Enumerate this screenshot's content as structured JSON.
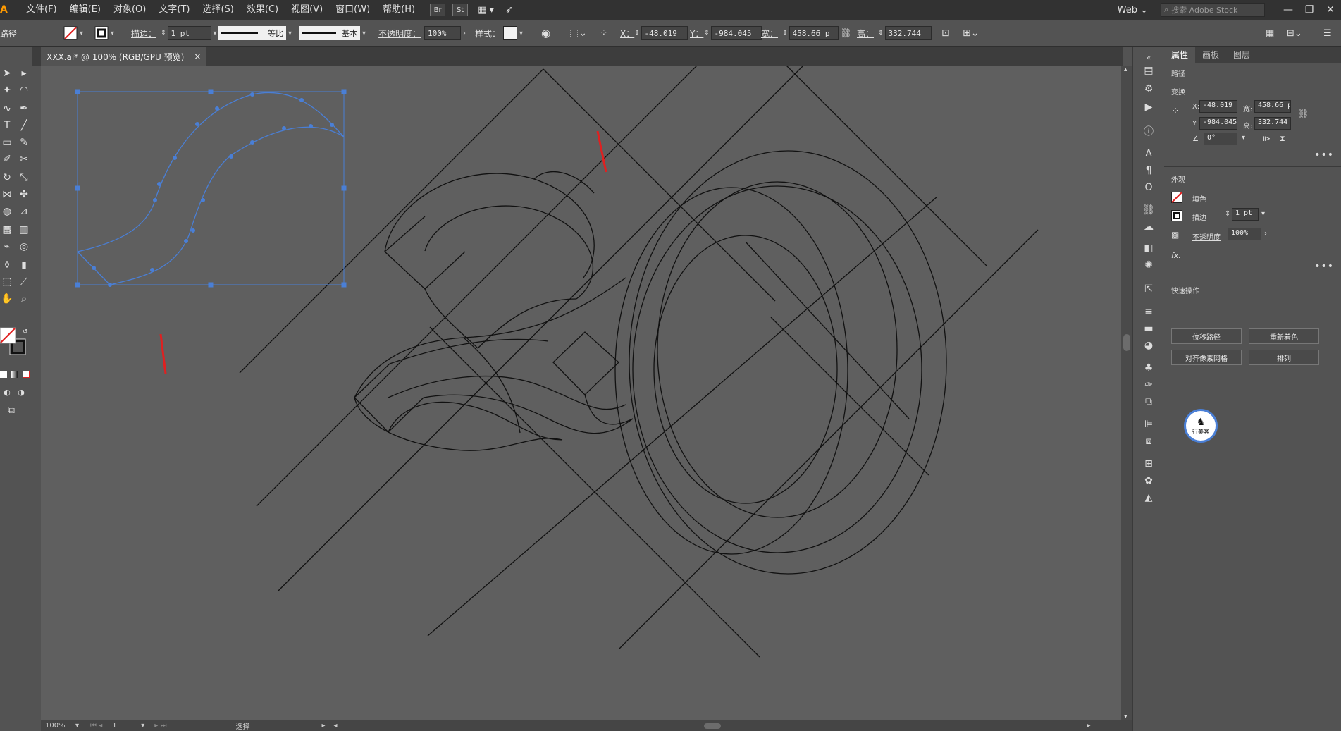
{
  "app": {
    "logo": "Ai"
  },
  "menu": [
    "文件(F)",
    "编辑(E)",
    "对象(O)",
    "文字(T)",
    "选择(S)",
    "效果(C)",
    "视图(V)",
    "窗口(W)",
    "帮助(H)"
  ],
  "menubar_buttons": {
    "bridge": "Br",
    "stock": "St"
  },
  "workspace": "Web",
  "search": {
    "placeholder": "搜索 Adobe Stock"
  },
  "window_controls": {
    "minimize": "—",
    "restore": "❐",
    "close": "✕"
  },
  "controlbar": {
    "object_type": "路径",
    "stroke_label": "描边：",
    "stroke_weight": "1 pt",
    "profile_label": "等比",
    "brush_label": "基本",
    "opacity_label": "不透明度：",
    "opacity_value": "100%",
    "style_label": "样式：",
    "x_label": "X：",
    "x_value": "-48.019",
    "y_label": "Y：",
    "y_value": "-984.045",
    "w_label": "宽：",
    "w_value": "458.66 p",
    "h_label": "高：",
    "h_value": "332.744"
  },
  "document_tab": {
    "title": "XXX.ai* @ 100% (RGB/GPU 预览)",
    "close": "×"
  },
  "statusbar": {
    "zoom": "100%",
    "artboard": "1",
    "tool_status": "选择"
  },
  "properties": {
    "tabs": [
      "属性",
      "画板",
      "图层"
    ],
    "section_path": "路径",
    "transform_title": "变换",
    "x_label": "X:",
    "x_value": "-48.019",
    "y_label": "Y:",
    "y_value": "-984.045",
    "w_label": "宽:",
    "w_value": "458.66 p",
    "h_label": "高:",
    "h_value": "332.744",
    "angle_value": "0°",
    "appearance_title": "外观",
    "fill_label": "填色",
    "stroke_label": "描边",
    "stroke_value": "1 pt",
    "opacity_label": "不透明度",
    "opacity_value": "100%",
    "fx_label": "fx.",
    "quick_actions_title": "快速操作",
    "btn_offset_path": "位移路径",
    "btn_recolor": "重新着色",
    "btn_align_pixel": "对齐像素网格",
    "btn_arrange": "排列",
    "more": "•••"
  },
  "watermark": {
    "text": "行美客"
  },
  "colors": {
    "selection": "#4a7fd6",
    "annotation_arrow": "#e02020",
    "artwork_stroke": "#111111",
    "canvas": "#5f5f5f"
  }
}
